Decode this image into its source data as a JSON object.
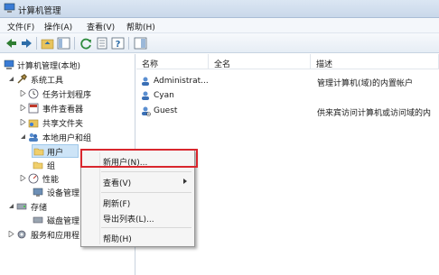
{
  "window": {
    "title": "计算机管理"
  },
  "menu": [
    "文件(F)",
    "操作(A)",
    "查看(V)",
    "帮助(H)"
  ],
  "tree": {
    "root": "计算机管理(本地)",
    "system_tools": "系统工具",
    "task_scheduler": "任务计划程序",
    "event_viewer": "事件查看器",
    "shared_folders": "共享文件夹",
    "local_users_groups": "本地用户和组",
    "users": "用户",
    "groups": "组",
    "performance": "性能",
    "device_manager": "设备管理",
    "storage": "存储",
    "disk_mgmt": "磁盘管理",
    "services_apps": "服务和应用程"
  },
  "list": {
    "columns": [
      "名称",
      "全名",
      "描述"
    ],
    "rows": [
      {
        "name": "Administrat...",
        "fullname": "",
        "desc": "管理计算机(域)的内置帐户"
      },
      {
        "name": "Cyan",
        "fullname": "",
        "desc": ""
      },
      {
        "name": "Guest",
        "fullname": "",
        "desc": "供来宾访问计算机或访问域的内"
      }
    ]
  },
  "context_menu": {
    "items": [
      "新用户(N)...",
      "查看(V)",
      "刷新(F)",
      "导出列表(L)...",
      "帮助(H)"
    ]
  },
  "colors": {
    "highlight_border": "#d9262d",
    "selection": "#cde4f7"
  }
}
